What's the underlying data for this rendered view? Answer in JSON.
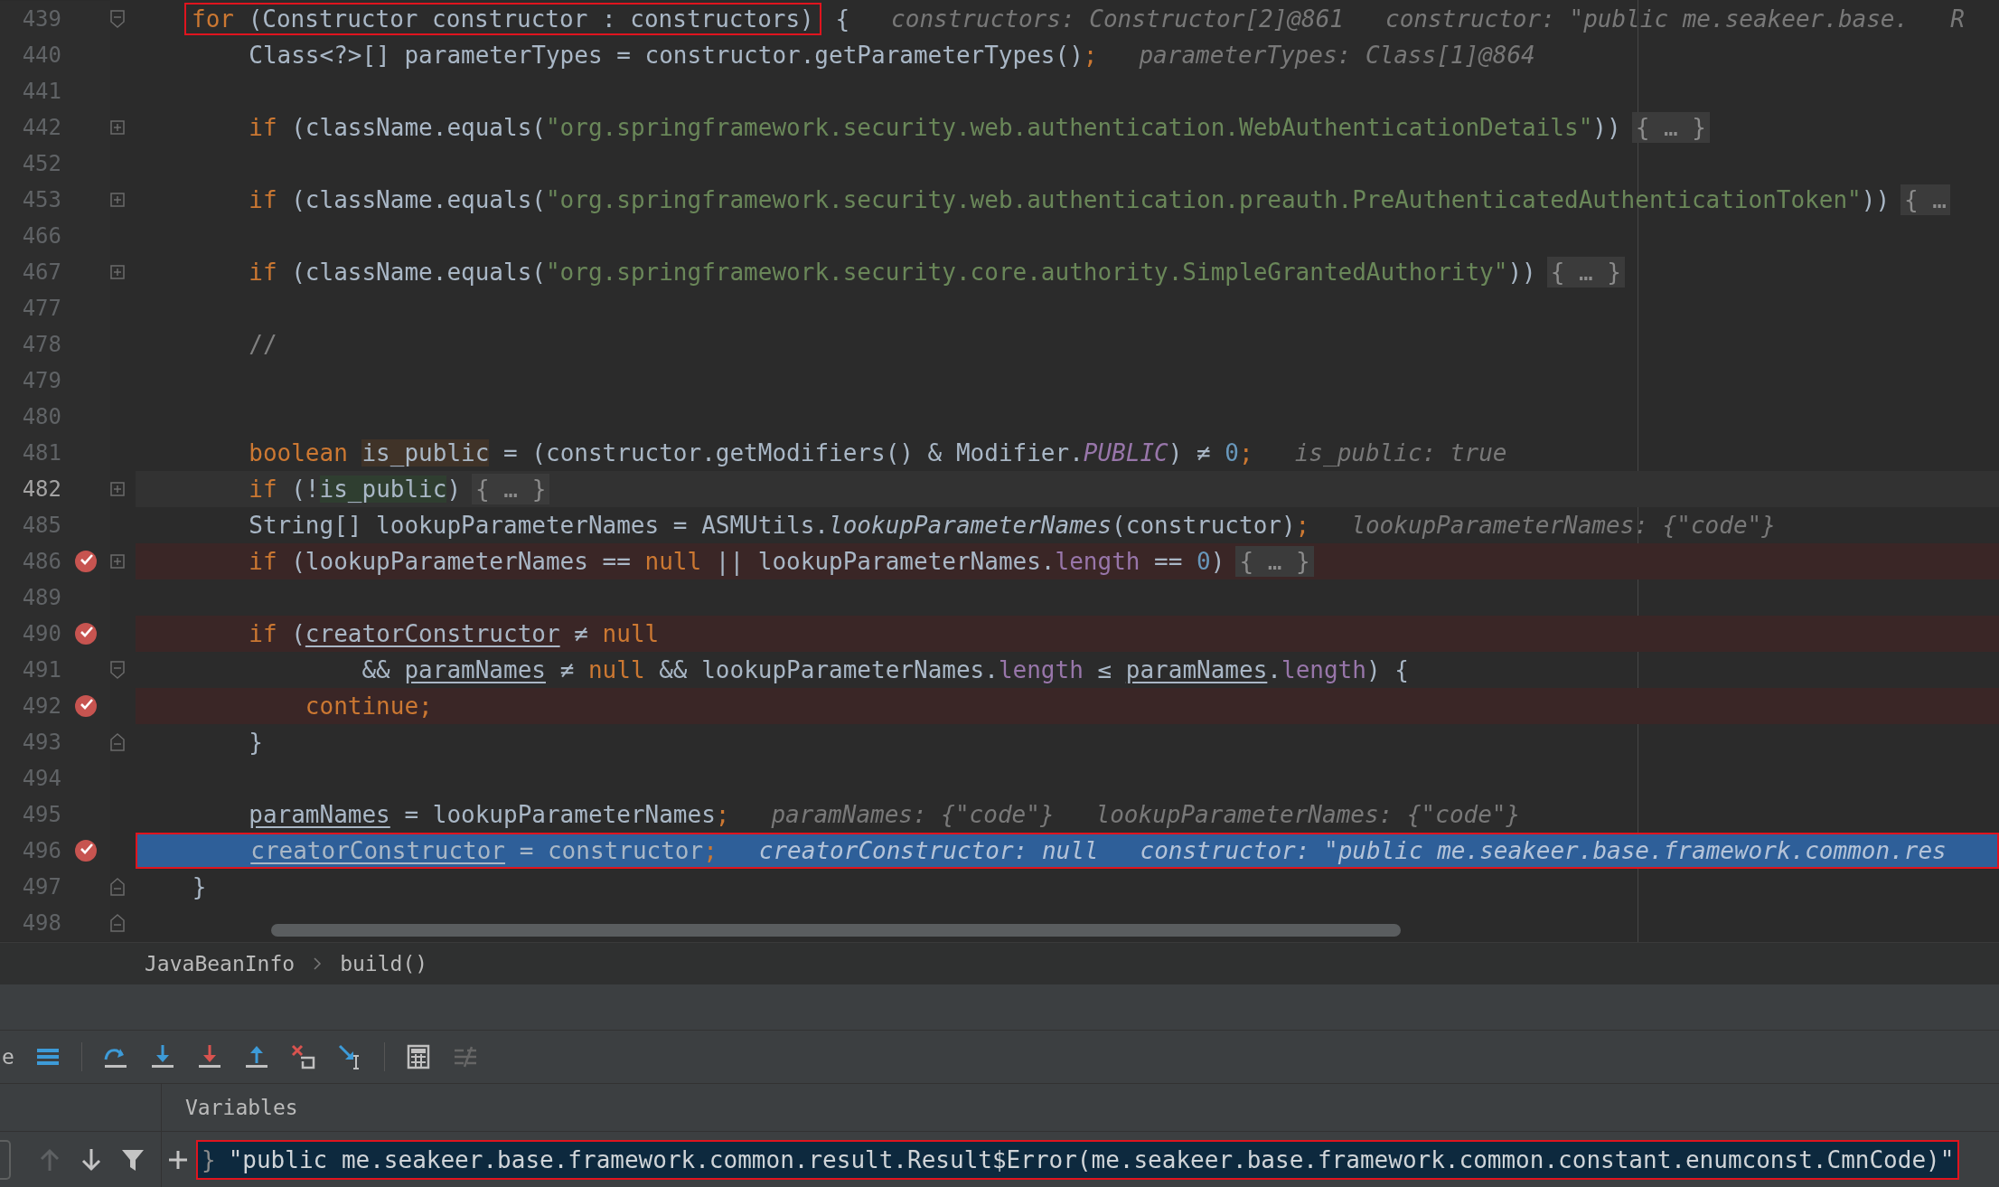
{
  "editor": {
    "lines": [
      {
        "number": "439",
        "kind": "fold-start",
        "breakpoint": false,
        "current": false,
        "caret": false,
        "boxed": false,
        "tokens": [
          {
            "kind": "group",
            "boxed": true,
            "children": [
              {
                "text": "for",
                "kind": "keyword"
              },
              {
                "text": " (Constructor constructor : constructors)",
                "kind": "plain"
              }
            ]
          },
          {
            "text": " {",
            "kind": "plain"
          },
          {
            "text": "constructors: Constructor[2]@861",
            "kind": "hint"
          },
          {
            "text": "constructor: \"public me.seakeer.base.",
            "kind": "hint"
          },
          {
            "text": "R",
            "kind": "hint"
          }
        ]
      },
      {
        "number": "440",
        "kind": "plain",
        "breakpoint": false,
        "current": false,
        "caret": false,
        "boxed": false,
        "tokens": [
          {
            "text": "        Class<?>[] parameterTypes = constructor.getParameterTypes()",
            "kind": "plain"
          },
          {
            "text": ";",
            "kind": "keyword"
          },
          {
            "text": "parameterTypes: Class[1]@864",
            "kind": "hint"
          }
        ]
      },
      {
        "number": "441",
        "kind": "plain",
        "breakpoint": false,
        "current": false,
        "caret": false,
        "boxed": false
      },
      {
        "number": "442",
        "kind": "folded",
        "breakpoint": false,
        "current": false,
        "caret": false,
        "boxed": false,
        "tokens": [
          {
            "text": "        if",
            "kind": "keyword"
          },
          {
            "text": " (className.equals(",
            "kind": "plain"
          },
          {
            "text": "\"org.springframework.security.web.authentication.WebAuthenticationDetails\"",
            "kind": "string"
          },
          {
            "text": "))",
            "kind": "plain"
          },
          {
            "text": "{ … }",
            "kind": "folded"
          }
        ]
      },
      {
        "number": "452",
        "kind": "plain",
        "breakpoint": false,
        "current": false,
        "caret": false,
        "boxed": false
      },
      {
        "number": "453",
        "kind": "folded",
        "breakpoint": false,
        "current": false,
        "caret": false,
        "boxed": false,
        "tokens": [
          {
            "text": "        if",
            "kind": "keyword"
          },
          {
            "text": " (className.equals(",
            "kind": "plain"
          },
          {
            "text": "\"org.springframework.security.web.authentication.preauth.PreAuthenticatedAuthenticationToken\"",
            "kind": "string"
          },
          {
            "text": "))",
            "kind": "plain"
          },
          {
            "text": "{ …",
            "kind": "folded"
          }
        ]
      },
      {
        "number": "466",
        "kind": "plain",
        "breakpoint": false,
        "current": false,
        "caret": false,
        "boxed": false
      },
      {
        "number": "467",
        "kind": "folded",
        "breakpoint": false,
        "current": false,
        "caret": false,
        "boxed": false,
        "tokens": [
          {
            "text": "        if",
            "kind": "keyword"
          },
          {
            "text": " (className.equals(",
            "kind": "plain"
          },
          {
            "text": "\"org.springframework.security.core.authority.SimpleGrantedAuthority\"",
            "kind": "string"
          },
          {
            "text": "))",
            "kind": "plain"
          },
          {
            "text": "{ … }",
            "kind": "folded"
          }
        ]
      },
      {
        "number": "477",
        "kind": "plain",
        "breakpoint": false,
        "current": false,
        "caret": false,
        "boxed": false
      },
      {
        "number": "478",
        "kind": "plain",
        "breakpoint": false,
        "current": false,
        "caret": false,
        "boxed": false,
        "tokens": [
          {
            "text": "        //",
            "kind": "comment"
          }
        ]
      },
      {
        "number": "479",
        "kind": "plain",
        "breakpoint": false,
        "current": false,
        "caret": false,
        "boxed": false
      },
      {
        "number": "480",
        "kind": "plain",
        "breakpoint": false,
        "current": false,
        "caret": false,
        "boxed": false
      },
      {
        "number": "481",
        "kind": "plain",
        "breakpoint": false,
        "current": false,
        "caret": false,
        "boxed": false,
        "tokens": [
          {
            "text": "        boolean ",
            "kind": "keyword"
          },
          {
            "text": "is_public",
            "kind": "usage-write"
          },
          {
            "text": " = (constructor.getModifiers() & Modifier.",
            "kind": "plain"
          },
          {
            "text": "PUBLIC",
            "kind": "constant"
          },
          {
            "text": ") ≠ ",
            "kind": "plain"
          },
          {
            "text": "0",
            "kind": "number"
          },
          {
            "text": ";",
            "kind": "keyword"
          },
          {
            "text": "is_public: true",
            "kind": "hint"
          }
        ]
      },
      {
        "number": "482",
        "kind": "folded",
        "breakpoint": false,
        "current": false,
        "caret": true,
        "boxed": false,
        "tokens": [
          {
            "text": "        if",
            "kind": "keyword"
          },
          {
            "text": " (!",
            "kind": "plain"
          },
          {
            "text": "is_public",
            "kind": "usage-read"
          },
          {
            "text": ")",
            "kind": "plain"
          },
          {
            "text": "{ … }",
            "kind": "folded"
          }
        ]
      },
      {
        "number": "485",
        "kind": "plain",
        "breakpoint": false,
        "current": false,
        "caret": false,
        "boxed": false,
        "tokens": [
          {
            "text": "        String[] lookupParameterNames = ASMUtils.",
            "kind": "plain"
          },
          {
            "text": "lookupParameterNames",
            "kind": "method"
          },
          {
            "text": "(constructor)",
            "kind": "plain"
          },
          {
            "text": ";",
            "kind": "keyword"
          },
          {
            "text": "lookupParameterNames: {\"code\"}",
            "kind": "hint"
          }
        ]
      },
      {
        "number": "486",
        "kind": "folded",
        "breakpoint": true,
        "current": false,
        "caret": false,
        "boxed": false,
        "tokens": [
          {
            "text": "        if",
            "kind": "keyword"
          },
          {
            "text": " (lookupParameterNames == ",
            "kind": "plain"
          },
          {
            "text": "null",
            "kind": "keyword"
          },
          {
            "text": " || lookupParameterNames.",
            "kind": "plain"
          },
          {
            "text": "length",
            "kind": "field"
          },
          {
            "text": " == ",
            "kind": "plain"
          },
          {
            "text": "0",
            "kind": "number"
          },
          {
            "text": ")",
            "kind": "plain"
          },
          {
            "text": "{ … }",
            "kind": "folded"
          }
        ]
      },
      {
        "number": "489",
        "kind": "plain",
        "breakpoint": false,
        "current": false,
        "caret": false,
        "boxed": false
      },
      {
        "number": "490",
        "kind": "plain",
        "breakpoint": true,
        "current": false,
        "caret": false,
        "boxed": false,
        "tokens": [
          {
            "text": "        if",
            "kind": "keyword"
          },
          {
            "text": " (",
            "kind": "plain"
          },
          {
            "text": "creatorConstructor",
            "kind": "var"
          },
          {
            "text": " ≠ ",
            "kind": "plain"
          },
          {
            "text": "null",
            "kind": "keyword"
          }
        ]
      },
      {
        "number": "491",
        "kind": "fold-start",
        "breakpoint": false,
        "current": false,
        "caret": false,
        "boxed": false,
        "tokens": [
          {
            "text": "                && ",
            "kind": "plain"
          },
          {
            "text": "paramNames",
            "kind": "var"
          },
          {
            "text": " ≠ ",
            "kind": "plain"
          },
          {
            "text": "null",
            "kind": "keyword"
          },
          {
            "text": " && lookupParameterNames.",
            "kind": "plain"
          },
          {
            "text": "length",
            "kind": "field"
          },
          {
            "text": " ≤ ",
            "kind": "plain"
          },
          {
            "text": "paramNames",
            "kind": "var"
          },
          {
            "text": ".",
            "kind": "plain"
          },
          {
            "text": "length",
            "kind": "field"
          },
          {
            "text": ") {",
            "kind": "plain"
          }
        ]
      },
      {
        "number": "492",
        "kind": "plain",
        "breakpoint": true,
        "current": false,
        "caret": false,
        "boxed": false,
        "tokens": [
          {
            "text": "            continue;",
            "kind": "keyword"
          }
        ]
      },
      {
        "number": "493",
        "kind": "fold-end",
        "breakpoint": false,
        "current": false,
        "caret": false,
        "boxed": false,
        "tokens": [
          {
            "text": "        }",
            "kind": "plain"
          }
        ]
      },
      {
        "number": "494",
        "kind": "plain",
        "breakpoint": false,
        "current": false,
        "caret": false,
        "boxed": false
      },
      {
        "number": "495",
        "kind": "plain",
        "breakpoint": false,
        "current": false,
        "caret": false,
        "boxed": false,
        "tokens": [
          {
            "text": "        paramNames",
            "kind": "var"
          },
          {
            "text": " = lookupParameterNames",
            "kind": "plain"
          },
          {
            "text": ";",
            "kind": "keyword"
          },
          {
            "text": "paramNames: {\"code\"}",
            "kind": "hint"
          },
          {
            "text": "lookupParameterNames: {\"code\"}",
            "kind": "hint"
          }
        ]
      },
      {
        "number": "496",
        "kind": "plain",
        "breakpoint": true,
        "current": true,
        "caret": false,
        "boxed": true,
        "tokens": [
          {
            "text": "        creatorConstructor",
            "kind": "var"
          },
          {
            "text": " = constructor",
            "kind": "plain"
          },
          {
            "text": ";",
            "kind": "keyword"
          },
          {
            "text": "creatorConstructor: null",
            "kind": "hint"
          },
          {
            "text": "constructor: \"public me.seakeer.base.framework.common.res",
            "kind": "hint"
          }
        ]
      },
      {
        "number": "497",
        "kind": "fold-end",
        "breakpoint": false,
        "current": false,
        "caret": false,
        "boxed": false,
        "tokens": [
          {
            "text": "    }",
            "kind": "plain"
          }
        ]
      },
      {
        "number": "498",
        "kind": "fold-end",
        "breakpoint": false,
        "current": false,
        "caret": false,
        "boxed": false
      }
    ]
  },
  "breadcrumbs": [
    "JavaBeanInfo",
    "build()"
  ],
  "debugger": {
    "cut_label": "e",
    "toolbar": [
      {
        "kind": "frames",
        "disabled": false
      },
      {
        "kind": "step-over",
        "disabled": false
      },
      {
        "kind": "step-into",
        "disabled": false
      },
      {
        "kind": "force-step-into",
        "disabled": false
      },
      {
        "kind": "step-out",
        "disabled": false
      },
      {
        "kind": "drop-frame",
        "disabled": false
      },
      {
        "kind": "run-to-cursor",
        "disabled": false
      },
      {
        "kind": "evaluate",
        "disabled": false
      },
      {
        "kind": "trace",
        "disabled": true
      }
    ],
    "frame_nav": [
      {
        "kind": "up",
        "disabled": true
      },
      {
        "kind": "down",
        "disabled": false
      },
      {
        "kind": "filter",
        "disabled": false
      }
    ],
    "variables_title": "Variables",
    "value": {
      "brace": "}",
      "text": "\"public me.seakeer.base.framework.common.result.Result$Error(me.seakeer.base.framework.common.constant.enumconst.CmnCode)\"",
      "boxed": true
    }
  }
}
